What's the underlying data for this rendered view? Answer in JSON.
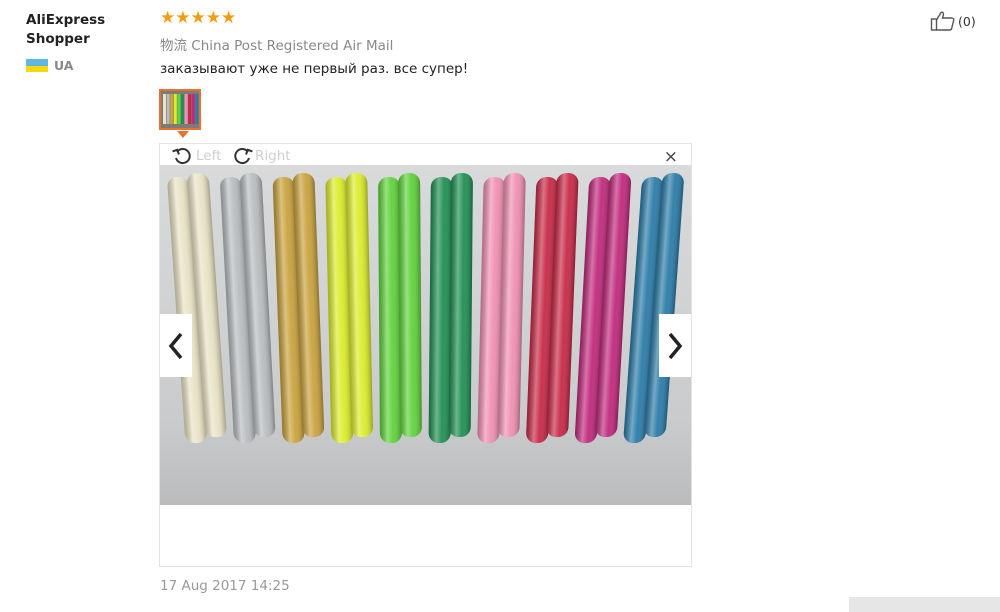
{
  "reviewer": {
    "name": "AliExpress Shopper",
    "country_code": "UA",
    "flag_colors": [
      "#f5d80f",
      "#5eb6e4"
    ]
  },
  "review": {
    "rating": 5,
    "star_color": "#f39c12",
    "shipping_prefix": "物流",
    "shipping_method": "China Post Registered Air Mail",
    "text": "заказывают уже не первый раз. все супер!",
    "date": "17 Aug 2017 14:25"
  },
  "helpful": {
    "count_label": "(0)"
  },
  "viewer": {
    "rotate_left_label": "Left",
    "rotate_right_label": "Right",
    "close_symbol": "×"
  },
  "photo_colors": [
    "#e8e3c4",
    "#b8bcbf",
    "#c9a23c",
    "#dbec2a",
    "#5fd23b",
    "#1f8f52",
    "#f08fb1",
    "#c82846",
    "#c1287c",
    "#2a7ba8"
  ]
}
